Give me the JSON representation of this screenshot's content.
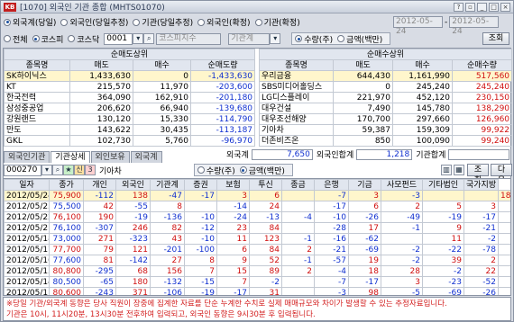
{
  "window": {
    "title": "[1070] 외국인 기관 종합 (MHTS01070)"
  },
  "filters": {
    "investor_types": [
      "외국계(당일)",
      "외국인(당일추정)",
      "기관(당일추정)",
      "외국인(확정)",
      "기관(확정)"
    ],
    "market_types": [
      "전체",
      "코스피",
      "코스닥"
    ],
    "code": "0001",
    "code_name": "코스피지수",
    "period_label": "기관계",
    "units": [
      "수량(주)",
      "금액(백만)"
    ],
    "date_from": "2012-05-24",
    "date_to": "2012-05-24",
    "query_label": "조회"
  },
  "top_tables": {
    "sell": {
      "title": "순매도상위",
      "headers": [
        "종목명",
        "매도",
        "매수",
        "순매도량"
      ],
      "rows": [
        [
          "SK하이닉스",
          "1,433,630",
          "0",
          "-1,433,630"
        ],
        [
          "KT",
          "215,570",
          "11,970",
          "-203,600"
        ],
        [
          "한국전력",
          "364,090",
          "162,910",
          "-201,180"
        ],
        [
          "삼성중공업",
          "206,620",
          "66,940",
          "-139,680"
        ],
        [
          "강원랜드",
          "130,120",
          "15,330",
          "-114,790"
        ],
        [
          "만도",
          "143,622",
          "30,435",
          "-113,187"
        ],
        [
          "GKL",
          "102,730",
          "5,760",
          "-96,970"
        ]
      ]
    },
    "buy": {
      "title": "순매수상위",
      "headers": [
        "종목명",
        "매도",
        "매수",
        "순매수량"
      ],
      "rows": [
        [
          "우리금융",
          "644,430",
          "1,161,990",
          "517,560"
        ],
        [
          "SBS미디어홀딩스",
          "0",
          "245,240",
          "245,240"
        ],
        [
          "LG디스플레이",
          "221,970",
          "452,120",
          "230,150"
        ],
        [
          "대우건설",
          "7,490",
          "145,780",
          "138,290"
        ],
        [
          "대우조선해양",
          "170,700",
          "297,660",
          "126,960"
        ],
        [
          "기아차",
          "59,387",
          "159,309",
          "99,922"
        ],
        [
          "더존비즈온",
          "850",
          "100,090",
          "99,240"
        ]
      ]
    }
  },
  "summary": {
    "foreign_label": "외국계",
    "foreign_value": "7,650",
    "foreign_total_label": "외국인합계",
    "foreign_total_value": "1,218",
    "inst_total_label": "기관합계",
    "inst_total_value": ""
  },
  "bottom": {
    "tabs": [
      "외국인기관",
      "기관상세",
      "외인보유",
      "외국계"
    ],
    "code": "000270",
    "stock_name": "기아차",
    "units": [
      "수량(주)",
      "금액(백만)"
    ],
    "query_label": "조회",
    "next_label": "다음",
    "headers": [
      "일자",
      "종가",
      "개인",
      "외국인",
      "기관계",
      "증권",
      "보험",
      "투신",
      "종금",
      "은행",
      "기금",
      "사모펀드",
      "기타법인",
      "국가지방"
    ],
    "rows": [
      {
        "date": "2012/05/24",
        "close": "75,900",
        "up": true,
        "vals": [
          "-112",
          "138",
          "-47",
          "-17",
          "3",
          "6",
          "",
          "-7",
          "3",
          "-3",
          "",
          "",
          "18"
        ]
      },
      {
        "date": "2012/05/23",
        "close": "75,500",
        "up": false,
        "vals": [
          "42",
          "-55",
          "8",
          "",
          "-14",
          "24",
          "",
          "-17",
          "6",
          "2",
          "5",
          "3",
          ""
        ]
      },
      {
        "date": "2012/05/22",
        "close": "76,100",
        "up": true,
        "vals": [
          "190",
          "-19",
          "-136",
          "-10",
          "-24",
          "-13",
          "-4",
          "-10",
          "-26",
          "-49",
          "-19",
          "-17",
          ""
        ]
      },
      {
        "date": "2012/05/21",
        "close": "76,100",
        "up": false,
        "vals": [
          "-307",
          "246",
          "82",
          "-12",
          "23",
          "84",
          "",
          "-28",
          "17",
          "-1",
          "9",
          "-21",
          ""
        ]
      },
      {
        "date": "2012/05/18",
        "close": "73,000",
        "up": false,
        "vals": [
          "271",
          "-323",
          "43",
          "-10",
          "11",
          "123",
          "-1",
          "-16",
          "-62",
          "",
          "11",
          "-2",
          ""
        ]
      },
      {
        "date": "2012/05/17",
        "close": "77,700",
        "up": true,
        "vals": [
          "79",
          "121",
          "-201",
          "-100",
          "6",
          "84",
          "2",
          "-21",
          "-69",
          "-2",
          "-22",
          "-78",
          ""
        ]
      },
      {
        "date": "2012/05/16",
        "close": "77,600",
        "up": false,
        "vals": [
          "81",
          "-142",
          "27",
          "8",
          "9",
          "52",
          "-1",
          "-57",
          "19",
          "-2",
          "39",
          "2",
          ""
        ]
      },
      {
        "date": "2012/05/15",
        "close": "80,800",
        "up": true,
        "vals": [
          "-295",
          "68",
          "156",
          "7",
          "15",
          "89",
          "2",
          "-4",
          "18",
          "28",
          "-2",
          "22",
          ""
        ]
      },
      {
        "date": "2012/05/14",
        "close": "80,500",
        "up": false,
        "vals": [
          "-65",
          "180",
          "-132",
          "-15",
          "7",
          "-2",
          "",
          "-7",
          "-17",
          "3",
          "-23",
          "-52",
          ""
        ]
      },
      {
        "date": "2012/05/11",
        "close": "80,600",
        "up": true,
        "vals": [
          "-243",
          "371",
          "-106",
          "-19",
          "-17",
          "31",
          "",
          "-3",
          "98",
          "-5",
          "-69",
          "-26",
          ""
        ]
      }
    ]
  },
  "notice": [
    "※당일 기관/외국계 동향은 당사 직원이 장중에 집계한 자료를 단순 누계한 수치로 실제 매매규모와 차이가 발생할 수 있는 추정자료입니다.",
    "기관은 10시, 11시20분, 13시30분 전후하여 입력되고, 외국인 동향은 9시30분 후 입력됩니다."
  ]
}
